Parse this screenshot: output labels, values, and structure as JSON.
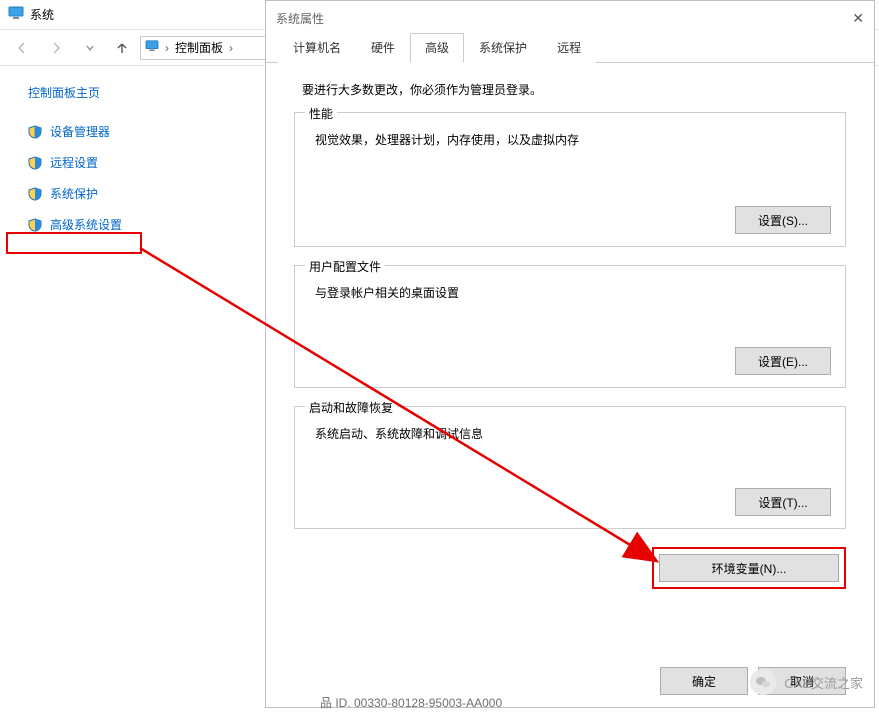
{
  "cp": {
    "title": "系统",
    "breadcrumb": {
      "item": "控制面板",
      "sep": "›"
    },
    "home": "控制面板主页",
    "links": [
      {
        "label": "设备管理器"
      },
      {
        "label": "远程设置"
      },
      {
        "label": "系统保护"
      },
      {
        "label": "高级系统设置"
      }
    ]
  },
  "dialog": {
    "title": "系统属性",
    "close": "✕",
    "tabs": [
      {
        "label": "计算机名"
      },
      {
        "label": "硬件"
      },
      {
        "label": "高级"
      },
      {
        "label": "系统保护"
      },
      {
        "label": "远程"
      }
    ],
    "activeTabIndex": 2,
    "intro": "要进行大多数更改，你必须作为管理员登录。",
    "groups": {
      "performance": {
        "legend": "性能",
        "desc": "视觉效果，处理器计划，内存使用，以及虚拟内存",
        "button": "设置(S)..."
      },
      "profiles": {
        "legend": "用户配置文件",
        "desc": "与登录帐户相关的桌面设置",
        "button": "设置(E)..."
      },
      "startup": {
        "legend": "启动和故障恢复",
        "desc": "系统启动、系统故障和调试信息",
        "button": "设置(T)..."
      }
    },
    "envButton": "环境变量(N)...",
    "footer": {
      "ok": "确定",
      "cancel": "取消"
    }
  },
  "watermark": "CAE交流之家",
  "maskedId": "品 ID. 00330-80128-95003-AA000"
}
